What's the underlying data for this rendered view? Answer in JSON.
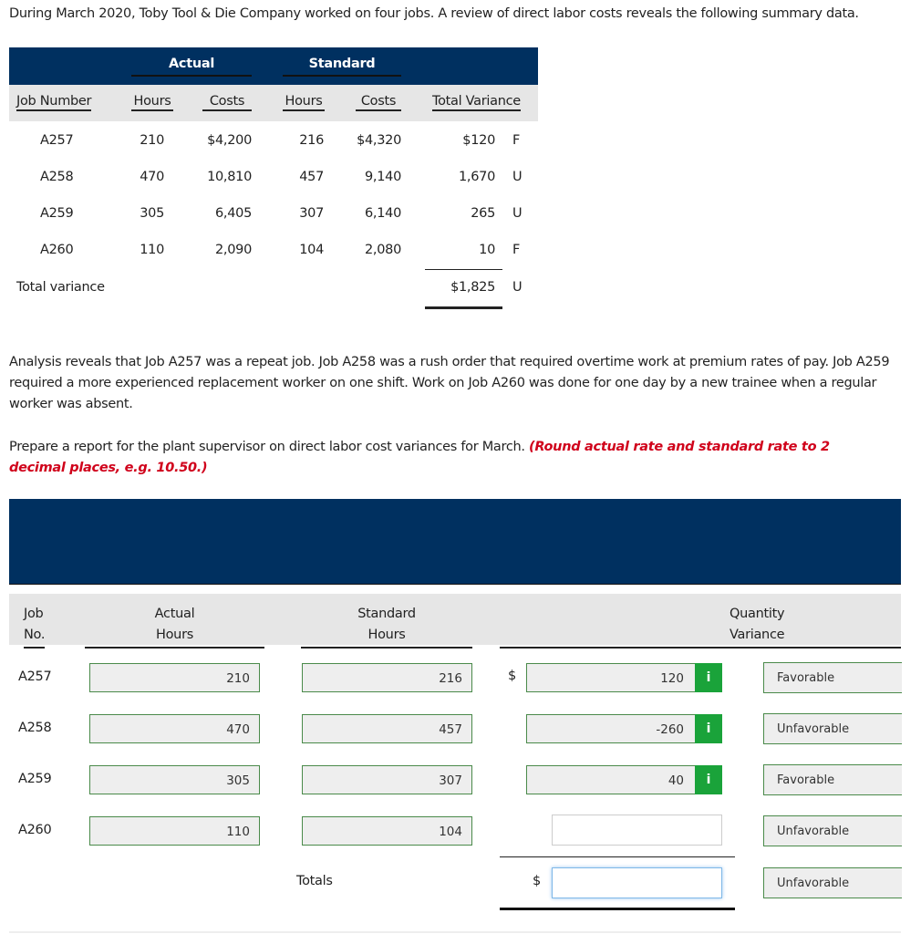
{
  "intro": "During March 2020, Toby Tool & Die Company worked on four jobs. A review of direct labor costs reveals the following summary data.",
  "summary": {
    "group_actual": "Actual",
    "group_standard": "Standard",
    "headers": [
      "Job Number",
      "Hours",
      "Costs",
      "Hours",
      "Costs",
      "Total Variance"
    ],
    "rows": [
      {
        "job": "A257",
        "ah": "210",
        "ac": "$4,200",
        "sh": "216",
        "sc": "$4,320",
        "tv": "$120",
        "fu": "F"
      },
      {
        "job": "A258",
        "ah": "470",
        "ac": "10,810",
        "sh": "457",
        "sc": "9,140",
        "tv": "1,670",
        "fu": "U"
      },
      {
        "job": "A259",
        "ah": "305",
        "ac": "6,405",
        "sh": "307",
        "sc": "6,140",
        "tv": "265",
        "fu": "U"
      },
      {
        "job": "A260",
        "ah": "110",
        "ac": "2,090",
        "sh": "104",
        "sc": "2,080",
        "tv": "10",
        "fu": "F"
      }
    ],
    "total_label": "Total variance",
    "total_value": "$1,825",
    "total_fu": "U"
  },
  "analysis": "Analysis reveals that Job A257 was a repeat job. Job A258 was a rush order that required overtime work at premium rates of pay. Job A259 required a more experienced replacement worker on one shift. Work on Job A260 was done for one day by a new trainee when a regular worker was absent.",
  "prepare": "Prepare a report for the plant supervisor on direct labor cost variances for March.",
  "prepare_note": "(Round actual rate and standard rate to 2 decimal places, e.g. 10.50.)",
  "report": {
    "h_job1": "Job",
    "h_job2": "No.",
    "h_ah1": "Actual",
    "h_ah2": "Hours",
    "h_sh1": "Standard",
    "h_sh2": "Hours",
    "h_qv1": "Quantity",
    "h_qv2": "Variance",
    "currency": "$",
    "info_icon": "i",
    "rows": [
      {
        "job": "A257",
        "ah": "210",
        "sh": "216",
        "qv": "120",
        "fu": "Favorable"
      },
      {
        "job": "A258",
        "ah": "470",
        "sh": "457",
        "qv": "-260",
        "fu": "Unfavorable"
      },
      {
        "job": "A259",
        "ah": "305",
        "sh": "307",
        "qv": "40",
        "fu": "Favorable"
      },
      {
        "job": "A260",
        "ah": "110",
        "sh": "104",
        "qv": "",
        "fu": "Unfavorable"
      }
    ],
    "totals_label": "Totals",
    "totals_value": "",
    "totals_fu": "Unfavorable"
  },
  "colors": {
    "header_band": "#003060",
    "input_border": "#4a8a4a",
    "info_button": "#1aa33a",
    "note": "#d0021b"
  }
}
